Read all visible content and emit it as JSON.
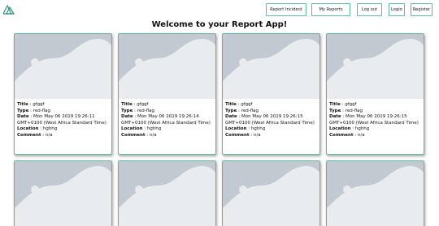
{
  "nav": {
    "report_incident": "Report Incident",
    "my_reports": "My Reports",
    "log_out": "Log out",
    "login": "Login",
    "register": "Register"
  },
  "page_title": "Welcome to your Report App!",
  "labels": {
    "title": "Title",
    "type": "Type",
    "date": "Date",
    "location": "Location",
    "comment": "Comment"
  },
  "reports": [
    {
      "title": "gfggf",
      "type": "red-flag",
      "date": "Mon May 06 2019 19:26:11 GMT+0100 (West Africa Standard Time)",
      "location": "hghhg",
      "comment": "n/a"
    },
    {
      "title": "gfggf",
      "type": "red-flag",
      "date": "Mon May 06 2019 19:26:14 GMT+0100 (West Africa Standard Time)",
      "location": "hghhg",
      "comment": "n/a"
    },
    {
      "title": "gfggf",
      "type": "red-flag",
      "date": "Mon May 06 2019 19:26:15 GMT+0100 (West Africa Standard Time)",
      "location": "hghhg",
      "comment": "n/a"
    },
    {
      "title": "gfggf",
      "type": "red-flag",
      "date": "Mon May 06 2019 19:26:15 GMT+0100 (West Africa Standard Time)",
      "location": "hghhg",
      "comment": "n/a"
    }
  ],
  "colors": {
    "accent": "#5fb89a",
    "placeholder_bg": "#c3c9d0",
    "placeholder_fg": "#e9ecef"
  }
}
